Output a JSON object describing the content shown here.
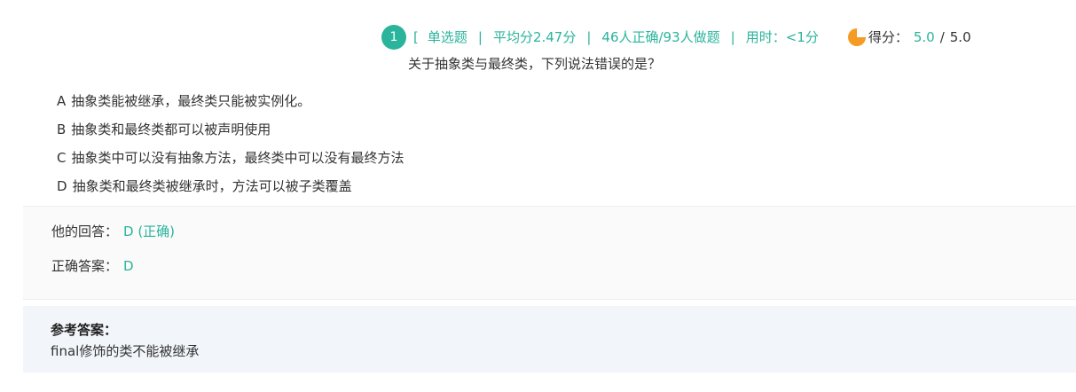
{
  "header": {
    "number": "1",
    "open_bracket": "[",
    "type": "单选题",
    "sep": "|",
    "avg": "平均分2.47分",
    "stats": "46人正确/93人做题",
    "time": "用时：<1分",
    "score_label": "得分：",
    "score_value": "5.0",
    "score_divider": "/",
    "score_max": "5.0",
    "accent_color": "#2bb49c",
    "score_icon_color": "#f59a23",
    "score_icon": "pie-chart-icon"
  },
  "question": "关于抽象类与最终类，下列说法错误的是？",
  "options": [
    {
      "letter": "A",
      "text": "抽象类能被继承，最终类只能被实例化。"
    },
    {
      "letter": "B",
      "text": "抽象类和最终类都可以被声明使用"
    },
    {
      "letter": "C",
      "text": "抽象类中可以没有抽象方法，最终类中可以没有最终方法"
    },
    {
      "letter": "D",
      "text": "抽象类和最终类被继承时，方法可以被子类覆盖"
    }
  ],
  "answer": {
    "his_label": "他的回答：",
    "his_value": "D (正确)",
    "correct_label": "正确答案：",
    "correct_value": "D"
  },
  "reference": {
    "title": "参考答案：",
    "body": "final修饰的类不能被继承"
  }
}
